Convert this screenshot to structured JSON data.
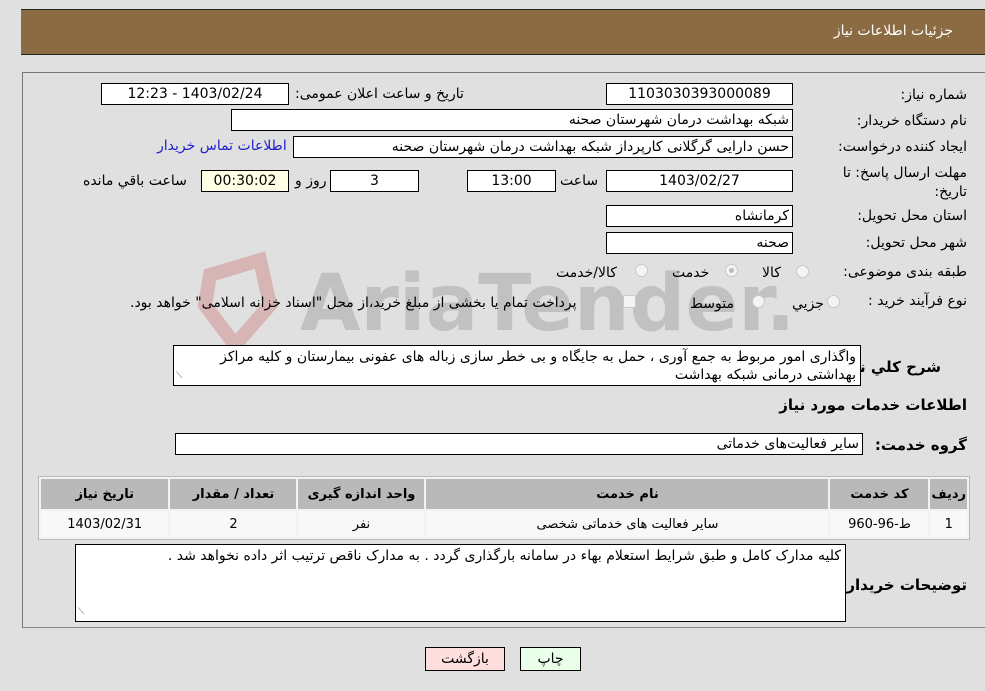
{
  "header": {
    "title": "جزئیات اطلاعات نیاز"
  },
  "form": {
    "need_number_label": "شماره نیاز:",
    "need_number": "1103030393000089",
    "announce_label": "تاریخ و ساعت اعلان عمومی:",
    "announce_value": "1403/02/24 - 12:23",
    "buyer_org_label": "نام دستگاه خریدار:",
    "buyer_org": "شبکه بهداشت درمان شهرستان صحنه",
    "creator_label": "ایجاد کننده درخواست:",
    "creator": "حسن دارایی گرگلانی کارپرداز شبکه بهداشت درمان شهرستان صحنه",
    "buyer_contact_link": "اطلاعات تماس خریدار",
    "deadline_label": "مهلت ارسال پاسخ: تا تاریخ:",
    "deadline_date": "1403/02/27",
    "time_label": "ساعت",
    "deadline_time": "13:00",
    "days": "3",
    "days_label": "روز و",
    "remaining": "00:30:02",
    "remaining_label": "ساعت باقي مانده",
    "province_label": "استان محل تحویل:",
    "province": "کرمانشاه",
    "city_label": "شهر محل تحویل:",
    "city": "صحنه",
    "category_label": "طبقه بندی موضوعی:",
    "category_options": [
      "کالا",
      "خدمت",
      "کالا/خدمت"
    ],
    "category_selected": "خدمت",
    "process_label": "نوع فرآیند خرید :",
    "process_options": [
      "جزیي",
      "متوسط"
    ],
    "payment_note": "پرداخت تمام یا بخشی از مبلغ خرید،از محل \"اسناد خزانه اسلامی\" خواهد بود.",
    "description_label": "شرح کلي نياز:",
    "description": "واگذاری امور مربوط به جمع آوری ، حمل به جایگاه و بی خطر سازی زباله های عفونی بیمارستان و کلیه مراکز بهداشتی درمانی شبکه بهداشت",
    "services_title": "اطلاعات خدمات مورد نیاز",
    "service_group_label": "گروه خدمت:",
    "service_group": "سایر فعالیت‌های خدماتی"
  },
  "table": {
    "headers": [
      "ردیف",
      "کد خدمت",
      "نام خدمت",
      "واحد اندازه گیری",
      "تعداد / مقدار",
      "تاریخ نیاز"
    ],
    "rows": [
      [
        "1",
        "ط-96-960",
        "سایر فعالیت های خدماتی شخصی",
        "نفر",
        "2",
        "1403/02/31"
      ]
    ]
  },
  "buyer_notes_label": "توضیحات خریدار:",
  "buyer_notes": "کلیه مدارک  کامل و طبق شرایط استعلام بهاء در سامانه بارگذاری گردد . به مدارک ناقص ترتیب اثر داده نخواهد شد .",
  "buttons": {
    "print": "چاپ",
    "back": "بازگشت"
  },
  "watermark": "AriaTender.neT"
}
